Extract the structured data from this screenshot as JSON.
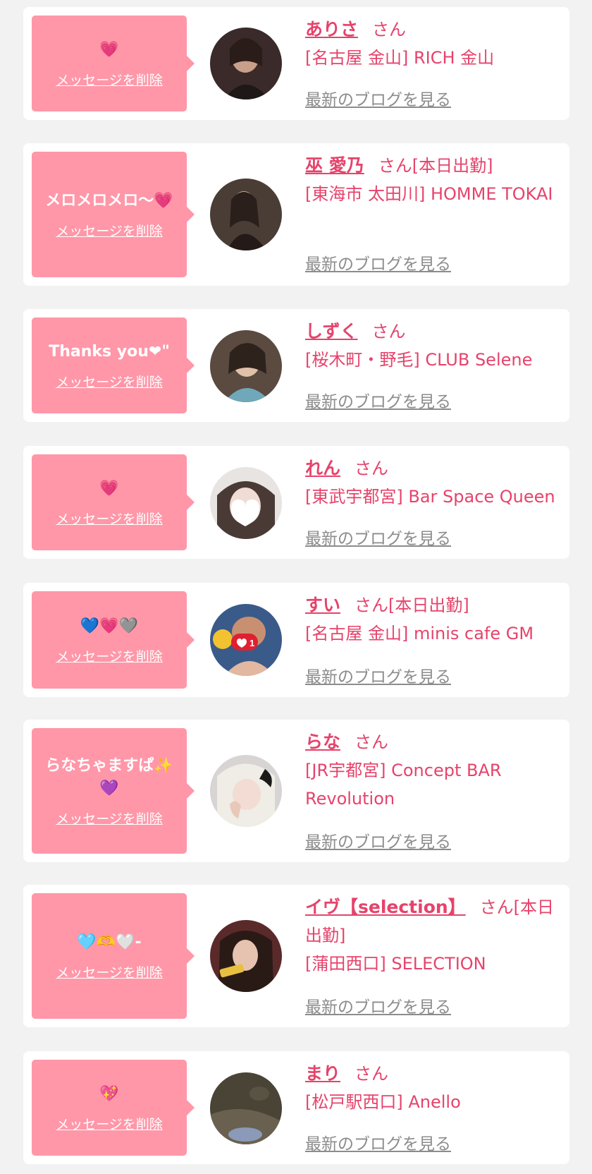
{
  "delete_label": "メッセージを削除",
  "blog_label": "最新のブログを見る",
  "colors": {
    "accent": "#e6436b",
    "bubble": "#ff97a8",
    "link_gray": "#8c8c8c",
    "background": "#f2f2f2"
  },
  "items": [
    {
      "message": "💗",
      "name": "ありさ",
      "suffix": "さん",
      "shop": "[名古屋 金山] RICH 金山"
    },
    {
      "message": "メロメロメロ〜💗",
      "name": "巫 愛乃",
      "suffix": "さん[本日出勤]",
      "shop": "[東海市 太田川] HOMME TOKAI"
    },
    {
      "message": "Thanks you❤\"",
      "name": "しずく",
      "suffix": "さん",
      "shop": "[桜木町・野毛] CLUB Selene"
    },
    {
      "message": "💗",
      "name": "れん",
      "suffix": "さん",
      "shop": "[東武宇都宮] Bar Space Queen"
    },
    {
      "message": "💙💗🩶",
      "name": "すい",
      "suffix": "さん[本日出勤]",
      "shop": "[名古屋 金山] minis cafe GM"
    },
    {
      "message": "らなちゃますぱ✨💜",
      "name": "らな",
      "suffix": "さん",
      "shop": "[JR宇都宮] Concept BAR Revolution"
    },
    {
      "message": "🩵🫶🤍-",
      "name": "イヴ【selection】",
      "suffix": "さん[本日出勤]",
      "shop": "[蒲田西口] SELECTION"
    },
    {
      "message": "💖",
      "name": "まり",
      "suffix": "さん",
      "shop": "[松戸駅西口] Anello"
    }
  ]
}
